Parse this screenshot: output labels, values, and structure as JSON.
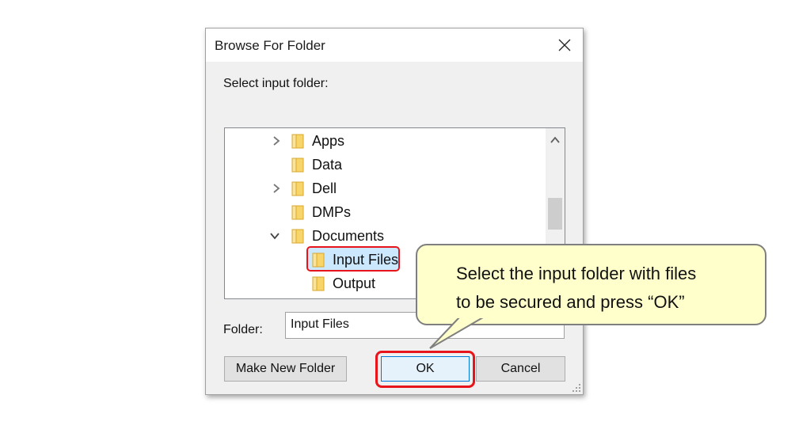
{
  "dialog": {
    "title": "Browse For Folder",
    "prompt": "Select input folder:",
    "tree": [
      {
        "label": "Apps",
        "expander": "collapsed"
      },
      {
        "label": "Data",
        "expander": "none"
      },
      {
        "label": "Dell",
        "expander": "collapsed"
      },
      {
        "label": "DMPs",
        "expander": "none"
      },
      {
        "label": "Documents",
        "expander": "expanded"
      },
      {
        "label": "Input Files",
        "expander": "none",
        "selected": true
      },
      {
        "label": "Output",
        "expander": "none"
      }
    ],
    "folder_label": "Folder:",
    "folder_value": "Input Files",
    "buttons": {
      "make_new_folder": "Make New Folder",
      "ok": "OK",
      "cancel": "Cancel"
    }
  },
  "callout": {
    "line1": "Select the input folder with files",
    "line2": "to be secured and press “OK”"
  },
  "colors": {
    "highlight": "#e8141b",
    "callout_bg": "#ffffcc",
    "selection_bg": "#cce8ff",
    "folder_yellow": "#f8d56b"
  },
  "icons": [
    "close-icon",
    "chevron-right-icon",
    "chevron-down-icon",
    "folder-icon",
    "scroll-up-arrow-icon",
    "resize-grip-icon"
  ]
}
